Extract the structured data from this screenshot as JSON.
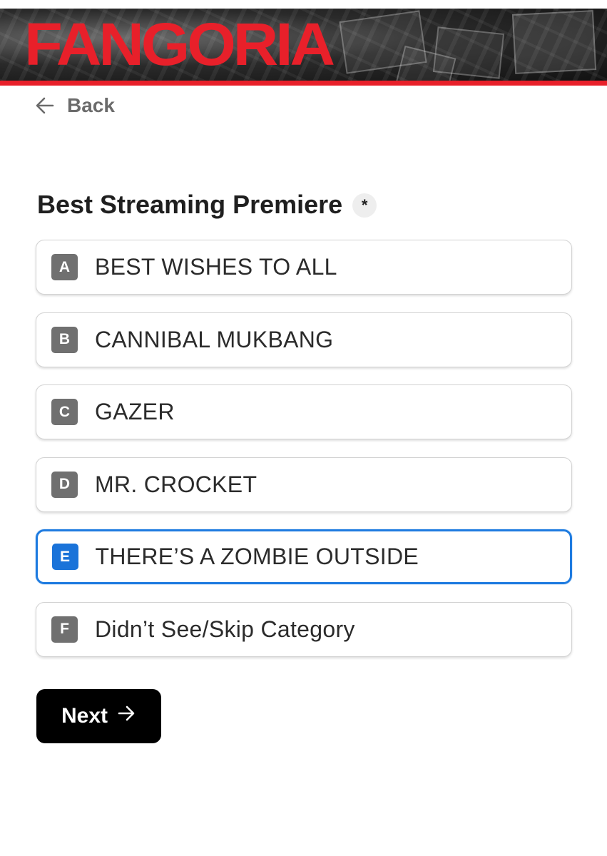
{
  "header": {
    "logo_text": "FANGORIA",
    "brand_color": "#e8202a"
  },
  "nav": {
    "back_label": "Back",
    "back_icon": "arrow-left-icon"
  },
  "question": {
    "title": "Best Streaming Premiere",
    "required_mark": "*"
  },
  "options": [
    {
      "key": "A",
      "label": "BEST WISHES TO ALL",
      "selected": false
    },
    {
      "key": "B",
      "label": "CANNIBAL MUKBANG",
      "selected": false
    },
    {
      "key": "C",
      "label": "GAZER",
      "selected": false
    },
    {
      "key": "D",
      "label": "MR. CROCKET",
      "selected": false
    },
    {
      "key": "E",
      "label": "THERE’S A ZOMBIE OUTSIDE",
      "selected": true
    },
    {
      "key": "F",
      "label": "Didn’t See/Skip Category",
      "selected": false
    }
  ],
  "footer": {
    "next_label": "Next",
    "next_icon": "arrow-right-icon"
  },
  "colors": {
    "selected_accent": "#1a73d9",
    "key_badge": "#707070",
    "next_button": "#000000"
  }
}
